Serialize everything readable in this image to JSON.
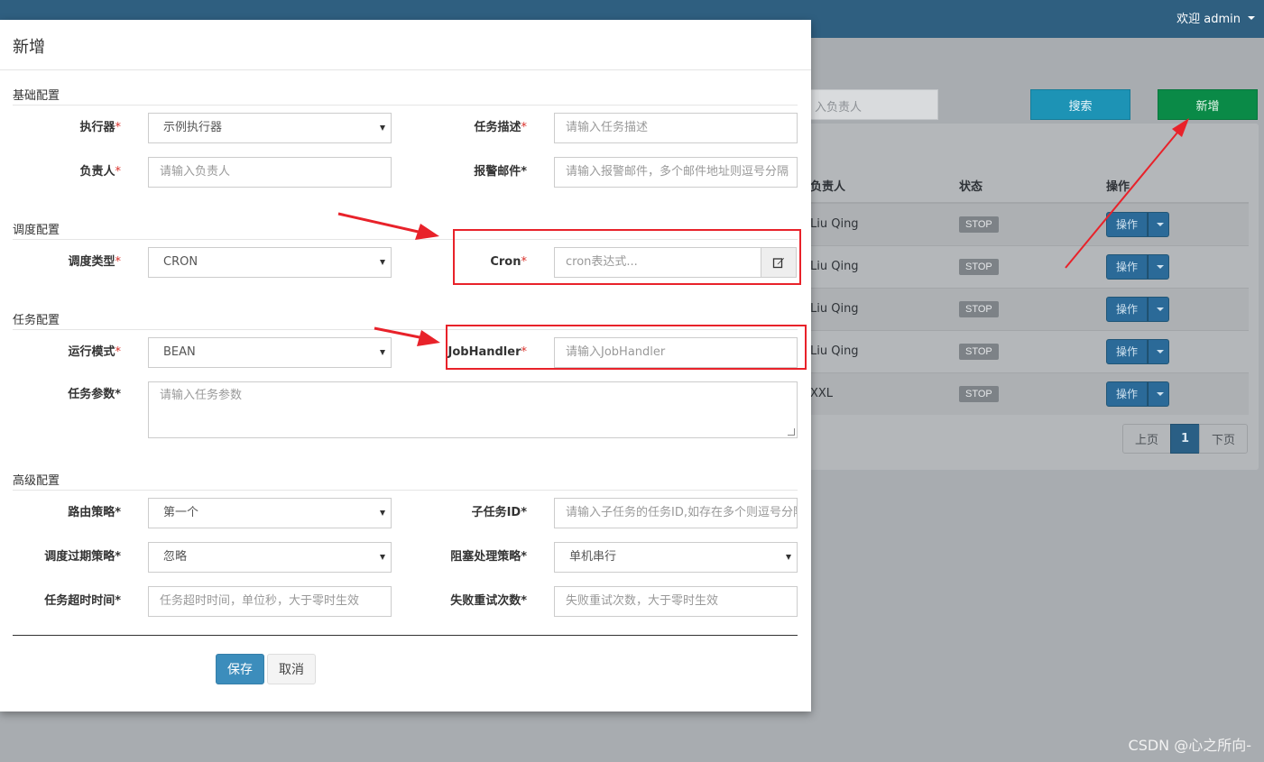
{
  "topbar": {
    "user_label": "欢迎 admin"
  },
  "background": {
    "filter_placeholder": "入负责人",
    "search_button": "搜索",
    "add_button": "新增",
    "table": {
      "headers": [
        "负责人",
        "状态",
        "操作"
      ],
      "rows": [
        {
          "owner": "Liu Qing",
          "status": "STOP",
          "action": "操作"
        },
        {
          "owner": "Liu Qing",
          "status": "STOP",
          "action": "操作"
        },
        {
          "owner": "Liu Qing",
          "status": "STOP",
          "action": "操作"
        },
        {
          "owner": "Liu Qing",
          "status": "STOP",
          "action": "操作"
        },
        {
          "owner": "XXL",
          "status": "STOP",
          "action": "操作"
        }
      ]
    },
    "pager": {
      "prev": "上页",
      "current": "1",
      "next": "下页"
    }
  },
  "modal": {
    "title": "新增",
    "sections": {
      "basic": "基础配置",
      "schedule": "调度配置",
      "task": "任务配置",
      "advanced": "高级配置"
    },
    "fields": {
      "executor": {
        "label": "执行器",
        "required": "*",
        "value": "示例执行器"
      },
      "job_desc": {
        "label": "任务描述",
        "required": "*",
        "placeholder": "请输入任务描述"
      },
      "author": {
        "label": "负责人",
        "required": "*",
        "placeholder": "请输入负责人"
      },
      "alarm_email": {
        "label": "报警邮件*",
        "placeholder": "请输入报警邮件，多个邮件地址则逗号分隔"
      },
      "schedule_type": {
        "label": "调度类型",
        "required": "*",
        "value": "CRON"
      },
      "cron": {
        "label": "Cron",
        "required": "*",
        "placeholder": "cron表达式..."
      },
      "glue_type": {
        "label": "运行模式",
        "required": "*",
        "value": "BEAN"
      },
      "job_handler": {
        "label": "JobHandler",
        "required": "*",
        "placeholder": "请输入JobHandler"
      },
      "job_param": {
        "label": "任务参数*",
        "placeholder": "请输入任务参数"
      },
      "route_strategy": {
        "label": "路由策略*",
        "value": "第一个"
      },
      "child_job": {
        "label": "子任务ID*",
        "placeholder": "请输入子任务的任务ID,如存在多个则逗号分隔"
      },
      "misfire_strategy": {
        "label": "调度过期策略*",
        "value": "忽略"
      },
      "block_strategy": {
        "label": "阻塞处理策略*",
        "value": "单机串行"
      },
      "timeout": {
        "label": "任务超时时间*",
        "placeholder": "任务超时时间，单位秒，大于零时生效"
      },
      "fail_retry": {
        "label": "失败重试次数*",
        "placeholder": "失败重试次数，大于零时生效"
      }
    },
    "buttons": {
      "save": "保存",
      "cancel": "取消"
    }
  },
  "watermark": "CSDN @心之所向-",
  "colors": {
    "annotation_red": "#e8222a",
    "topbar": "#2f5f80",
    "primary": "#3c8dbc",
    "add_green": "#0a8a47"
  },
  "icons": {
    "cron_generator": "edit-icon",
    "select_arrow": "caret-down-icon"
  }
}
